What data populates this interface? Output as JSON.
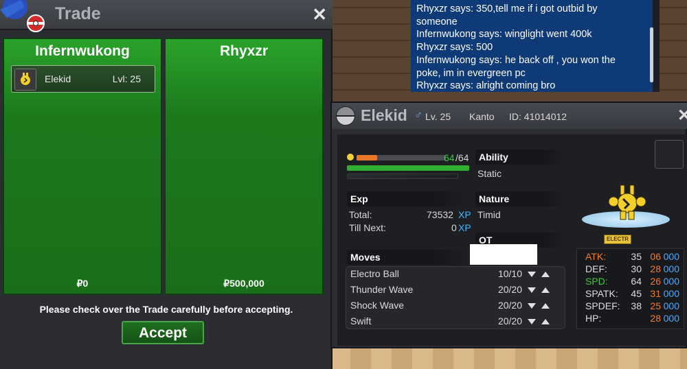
{
  "trade": {
    "title": "Trade",
    "close": "✕",
    "left": {
      "name": "Infernwukong",
      "money": "₽0",
      "pokemon": {
        "name": "Elekid",
        "level": "Lvl: 25"
      }
    },
    "right": {
      "name": "Rhyxzr",
      "money": "₽500,000"
    },
    "notice": "Please check over the Trade carefully before accepting.",
    "accept": "Accept"
  },
  "chat": {
    "lines": [
      "Rhyxzr says: 350,tell me if i got outbid by",
      "someone",
      "Infernwukong says: winglight went 400k",
      "Rhyxzr says: 500",
      "Infernwukong says: he back off , you won the",
      "poke, im in evergreen pc",
      "Rhyxzr says: alright coming bro"
    ]
  },
  "summary": {
    "name": "Elekid",
    "gender": "♂",
    "level": "Lv. 25",
    "region": "Kanto",
    "id": "ID: 41014012",
    "hp_current": "64",
    "hp_max": "/64",
    "hp_fraction": 1.0,
    "ability_label": "Ability",
    "ability": "Static",
    "exp_label": "Exp",
    "total_label": "Total:",
    "total_value": "73532",
    "till_label": "Till Next:",
    "till_value": "0",
    "xp_unit": "XP",
    "nature_label": "Nature",
    "nature": "Timid",
    "ot_label": "OT",
    "type_badge": "ELECTR",
    "moves_label": "Moves",
    "moves": [
      {
        "name": "Electro Ball",
        "pp": "10/10"
      },
      {
        "name": "Thunder Wave",
        "pp": "20/20"
      },
      {
        "name": "Shock Wave",
        "pp": "20/20"
      },
      {
        "name": "Swift",
        "pp": "20/20"
      }
    ],
    "stats": [
      {
        "name": "ATK:",
        "value": "35",
        "ev": "06",
        "iv": "000",
        "color": "#f07c2a"
      },
      {
        "name": "DEF:",
        "value": "30",
        "ev": "28",
        "iv": "000",
        "color": "#dddddd"
      },
      {
        "name": "SPD:",
        "value": "64",
        "ev": "26",
        "iv": "000",
        "color": "#3cc93c"
      },
      {
        "name": "SPATK:",
        "value": "45",
        "ev": "31",
        "iv": "000",
        "color": "#dddddd"
      },
      {
        "name": "SPDEF:",
        "value": "38",
        "ev": "25",
        "iv": "000",
        "color": "#dddddd"
      },
      {
        "name": "HP:",
        "value": "",
        "ev": "28",
        "iv": "000",
        "color": "#dddddd"
      }
    ],
    "close": "✕"
  },
  "colors": {
    "panel_green": "#1c7a1c",
    "chat_blue": "#0f3a78",
    "xp_blue": "#3cb8ff",
    "ev_orange": "#f07c2a"
  }
}
